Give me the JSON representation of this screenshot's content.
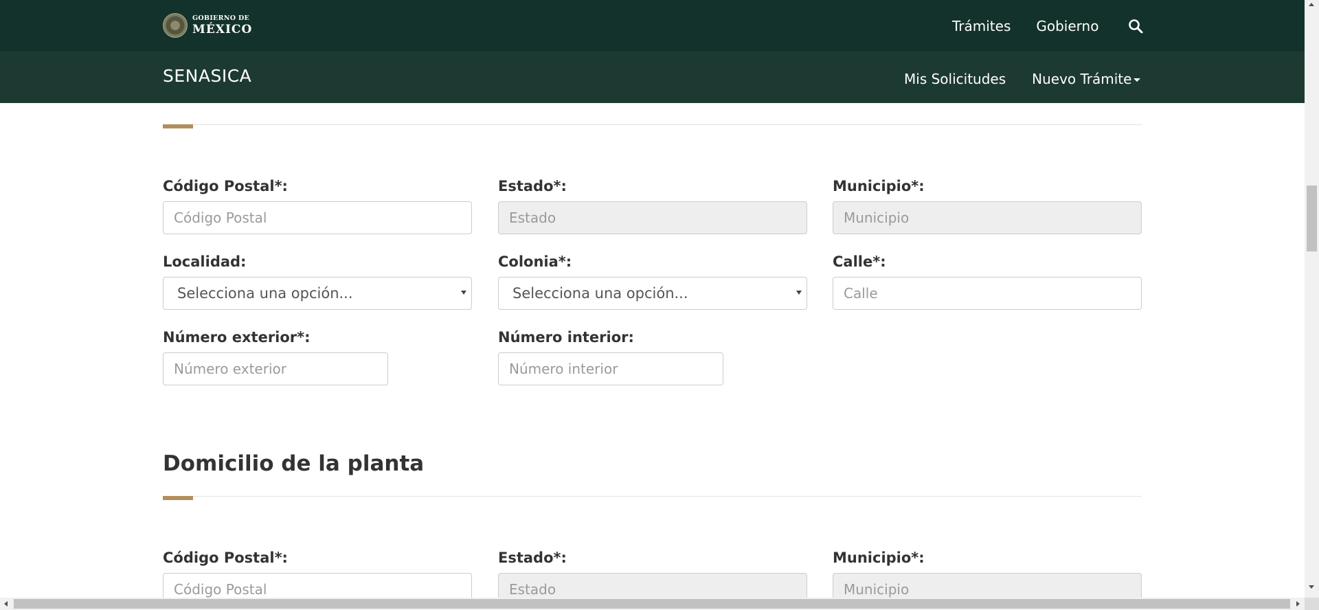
{
  "header": {
    "logo_line1": "GOBIERNO DE",
    "logo_line2": "MÉXICO",
    "links": [
      "Trámites",
      "Gobierno"
    ],
    "search_icon": "search-icon"
  },
  "subheader": {
    "brand": "SENASICA",
    "nav": [
      "Mis Solicitudes",
      "Nuevo Trámite"
    ]
  },
  "colors": {
    "topbar": "#13322b",
    "subbar": "#1d3a32",
    "accent": "#b38e5d",
    "disabled_field": "#eeeeee"
  },
  "form1": {
    "codigo_postal": {
      "label": "Código Postal*:",
      "placeholder": "Código Postal"
    },
    "estado": {
      "label": "Estado*:",
      "placeholder": "Estado"
    },
    "municipio": {
      "label": "Municipio*:",
      "placeholder": "Municipio"
    },
    "localidad": {
      "label": "Localidad:",
      "value": "Selecciona una opción..."
    },
    "colonia": {
      "label": "Colonia*:",
      "value": "Selecciona una opción..."
    },
    "calle": {
      "label": "Calle*:",
      "placeholder": "Calle"
    },
    "numero_exterior": {
      "label": "Número exterior*:",
      "placeholder": "Número exterior"
    },
    "numero_interior": {
      "label": "Número interior:",
      "placeholder": "Número interior"
    }
  },
  "section2": {
    "title": "Domicilio de la planta",
    "codigo_postal": {
      "label": "Código Postal*:",
      "placeholder": "Código Postal"
    },
    "estado": {
      "label": "Estado*:",
      "placeholder": "Estado"
    },
    "municipio": {
      "label": "Municipio*:",
      "placeholder": "Municipio"
    }
  }
}
